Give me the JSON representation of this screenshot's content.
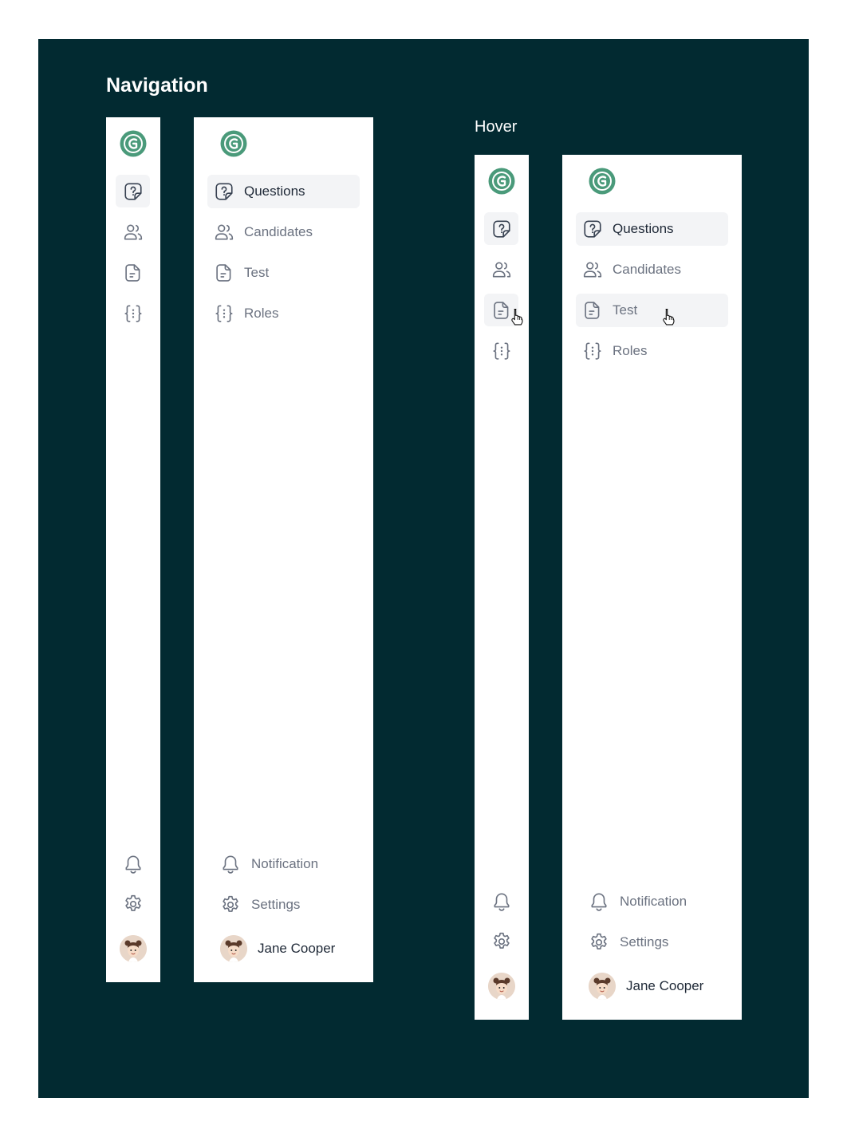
{
  "titles": {
    "main": "Navigation",
    "hover": "Hover"
  },
  "nav": {
    "items": [
      {
        "id": "questions",
        "label": "Questions",
        "icon": "question-square-icon"
      },
      {
        "id": "candidates",
        "label": "Candidates",
        "icon": "users-icon"
      },
      {
        "id": "test",
        "label": "Test",
        "icon": "document-icon"
      },
      {
        "id": "roles",
        "label": "Roles",
        "icon": "braces-icon"
      }
    ],
    "footer": {
      "notification": "Notification",
      "settings": "Settings"
    },
    "user": {
      "name": "Jane Cooper"
    }
  },
  "logo": {
    "letter": "G",
    "icon": "g-logo-icon"
  },
  "state": {
    "active_item": "questions",
    "hovered_item": "test"
  },
  "colors": {
    "background": "#022a31",
    "panel": "#ffffff",
    "active_bg": "#f3f4f6",
    "logo_green": "#4a9a7a",
    "text_muted": "#6b7280",
    "text_dark": "#1f2937"
  }
}
